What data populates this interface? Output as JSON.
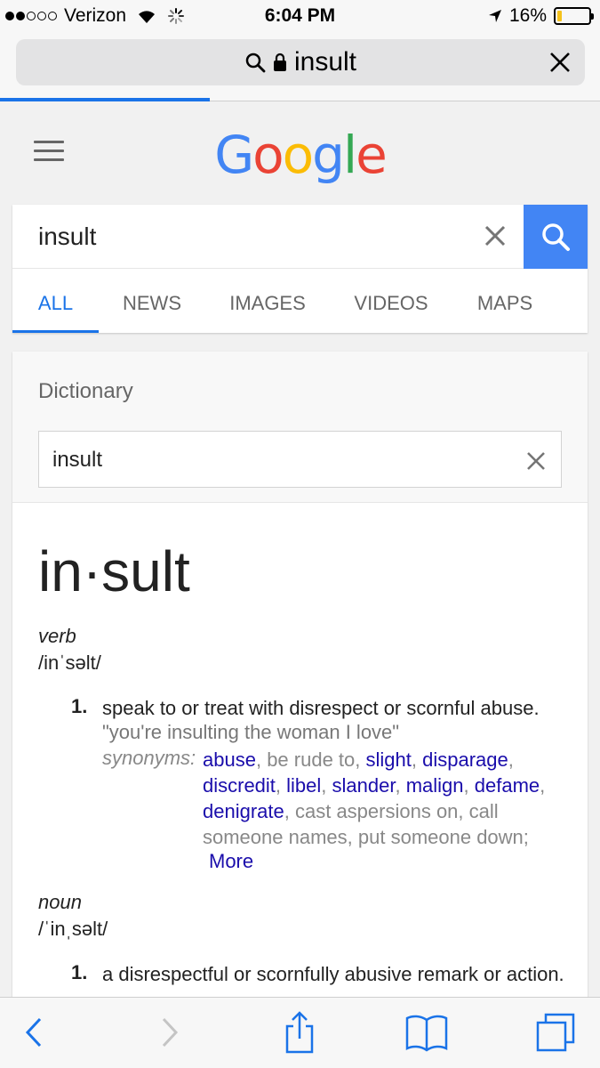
{
  "status_bar": {
    "carrier": "Verizon",
    "time": "6:04 PM",
    "battery": "16%",
    "battery_level": 0.16
  },
  "safari": {
    "url_text": "insult",
    "page_load_progress": 0.35
  },
  "google": {
    "search_value": "insult",
    "tabs": [
      "ALL",
      "NEWS",
      "IMAGES",
      "VIDEOS",
      "MAPS"
    ]
  },
  "dictionary": {
    "title": "Dictionary",
    "input_value": "insult",
    "headword": "in·sult",
    "verb": {
      "pos": "verb",
      "pronunciation": "/inˈsəlt/",
      "num": "1.",
      "definition": "speak to or treat with disrespect or scornful abuse.",
      "example": "\"you're insulting the woman I love\"",
      "synonyms_label": "synonyms:",
      "syn": {
        "abuse": "abuse",
        "be_rude": "be rude to",
        "slight": "slight",
        "disparage": "disparage",
        "discredit": "discredit",
        "libel": "libel",
        "slander": "slander",
        "malign": "malign",
        "defame": "defame",
        "denigrate": "denigrate",
        "cast": "cast aspersions on",
        "call": "call someone names",
        "put": "put someone down"
      },
      "more": "More"
    },
    "noun": {
      "pos": "noun",
      "pronunciation": "/ˈinˌsəlt/",
      "num": "1.",
      "definition": "a disrespectful or scornfully abusive remark or action."
    }
  },
  "colors": {
    "google_blue": "#4285f4",
    "link": "#1a0dab",
    "accent": "#1a73e8",
    "battery": "#f5c21b"
  }
}
